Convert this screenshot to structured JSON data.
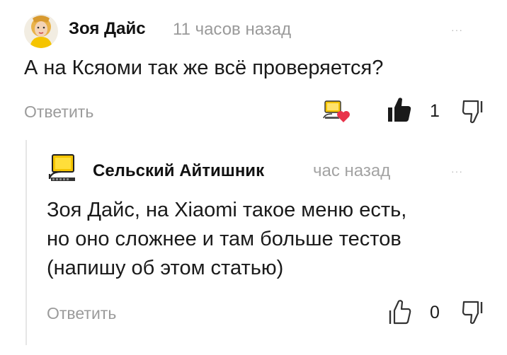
{
  "comments": [
    {
      "author": "Зоя Дайс",
      "time": "11 часов назад",
      "more": "···",
      "text": "А на Ксяоми так же всё проверяется?",
      "reply_label": "Ответить",
      "like_count": "1",
      "liked": true,
      "reacted_icon": "author-heart-icon"
    },
    {
      "author": "Сельский Айтишник",
      "time": "час назад",
      "more": "···",
      "text": "Зоя Дайс, на Xiaomi такое меню есть,\nно оно сложнее и там больше тестов\n(напишу об этом статью)",
      "reply_label": "Ответить",
      "like_count": "0",
      "liked": false
    }
  ],
  "colors": {
    "text": "#1a1a1a",
    "muted": "#9b9b9b",
    "heart": "#e8334a",
    "thread_line": "#e6e6e6",
    "avatar_yellow": "#f5c400"
  }
}
